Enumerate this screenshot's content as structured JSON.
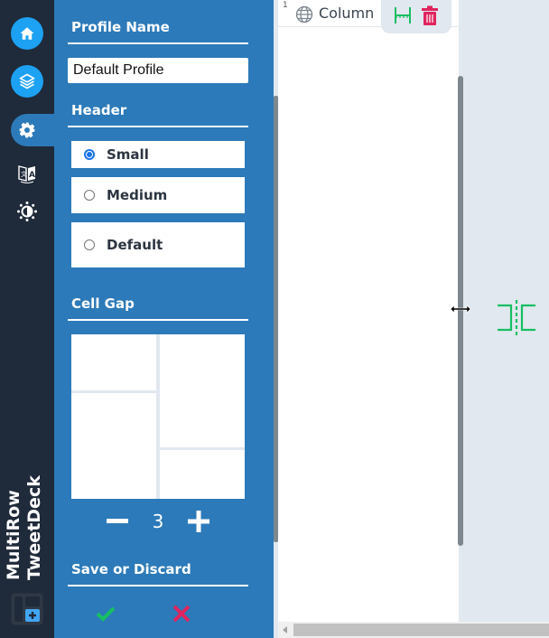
{
  "rail": {
    "items": [
      {
        "name": "home",
        "icon": "home-icon"
      },
      {
        "name": "columns",
        "icon": "layers-icon"
      },
      {
        "name": "settings",
        "icon": "gear-icon",
        "active": true
      },
      {
        "name": "language",
        "icon": "translate-icon"
      },
      {
        "name": "theme",
        "icon": "brightness-icon"
      }
    ],
    "brand_line1": "MultiRow",
    "brand_line2": "TweetDeck",
    "add_column_icon": "add-column-icon"
  },
  "settings": {
    "profile_name_title": "Profile Name",
    "profile_name_value": "Default Profile",
    "header_title": "Header",
    "header_options": [
      {
        "label": "Small",
        "checked": true
      },
      {
        "label": "Medium",
        "checked": false
      },
      {
        "label": "Default",
        "checked": false
      }
    ],
    "cell_gap_title": "Cell Gap",
    "cell_gap_value": "3",
    "save_discard_title": "Save or Discard"
  },
  "column": {
    "index": "1",
    "title": "Column",
    "icon": "globe-icon",
    "tools": [
      "resize-column-icon",
      "trash-icon"
    ]
  },
  "colors": {
    "rail_bg": "#1f2a3a",
    "panel_bg": "#2c7ab9",
    "accent_blue": "#1da1f2",
    "save_green": "#17bf63",
    "discard_red": "#e0245e",
    "workspace_bg": "#e1e8ef"
  }
}
